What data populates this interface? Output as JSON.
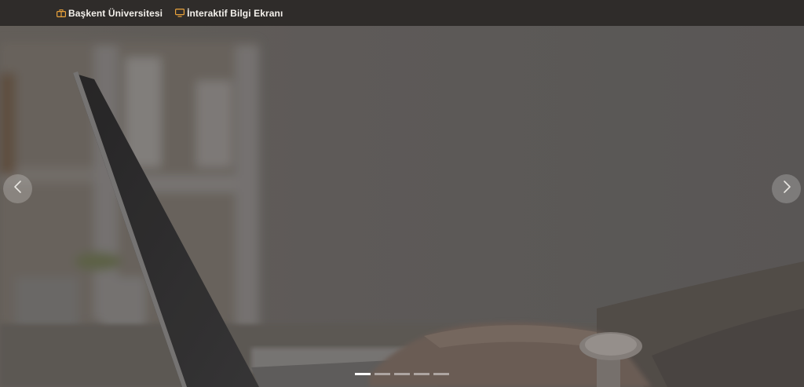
{
  "topbar": {
    "links": [
      {
        "label": "Başkent Üniversitesi",
        "icon": "building-icon"
      },
      {
        "label": "İnteraktif Bilgi Ekranı",
        "icon": "monitor-icon"
      }
    ],
    "accent_color": "#e9a23b"
  },
  "carousel": {
    "slide_count": 5,
    "active_slide": 1,
    "image_description_icon": "laptop-photo",
    "prev_icon": "chevron-left-icon",
    "next_icon": "chevron-right-icon"
  }
}
